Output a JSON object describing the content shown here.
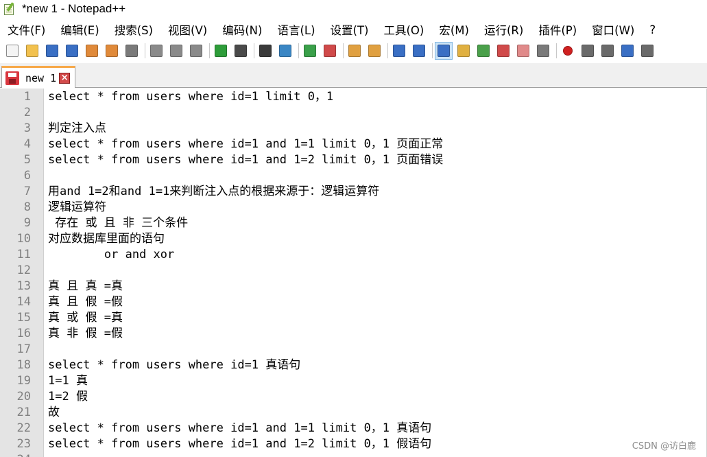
{
  "window": {
    "title": "*new 1 - Notepad++"
  },
  "menu": [
    "文件(F)",
    "编辑(E)",
    "搜索(S)",
    "视图(V)",
    "编码(N)",
    "语言(L)",
    "设置(T)",
    "工具(O)",
    "宏(M)",
    "运行(R)",
    "插件(P)",
    "窗口(W)",
    "?"
  ],
  "toolbar": {
    "icons": [
      {
        "name": "new-file-icon",
        "color": "#f4f4f4"
      },
      {
        "name": "open-file-icon",
        "color": "#f2c14e"
      },
      {
        "name": "save-icon",
        "color": "#3a6fc4"
      },
      {
        "name": "save-all-icon",
        "color": "#3a6fc4"
      },
      {
        "name": "close-icon",
        "color": "#e08a3a"
      },
      {
        "name": "close-all-icon",
        "color": "#e08a3a"
      },
      {
        "name": "print-icon",
        "color": "#7a7a7a"
      },
      {
        "name": "sep"
      },
      {
        "name": "cut-icon",
        "color": "#8a8a8a"
      },
      {
        "name": "copy-icon",
        "color": "#8a8a8a"
      },
      {
        "name": "paste-icon",
        "color": "#8a8a8a"
      },
      {
        "name": "sep"
      },
      {
        "name": "undo-icon",
        "color": "#2e9d3a"
      },
      {
        "name": "redo-icon",
        "color": "#4a4a4a"
      },
      {
        "name": "sep"
      },
      {
        "name": "find-icon",
        "color": "#3a3a3a"
      },
      {
        "name": "replace-icon",
        "color": "#3a86c4"
      },
      {
        "name": "sep"
      },
      {
        "name": "zoom-in-icon",
        "color": "#3aa04a"
      },
      {
        "name": "zoom-out-icon",
        "color": "#d04a4a"
      },
      {
        "name": "sep"
      },
      {
        "name": "sync-vertical-icon",
        "color": "#e0a040"
      },
      {
        "name": "sync-horizontal-icon",
        "color": "#e0a040"
      },
      {
        "name": "sep"
      },
      {
        "name": "word-wrap-icon",
        "color": "#3a6fc4"
      },
      {
        "name": "show-all-chars-icon",
        "color": "#3a6fc4"
      },
      {
        "name": "sep"
      },
      {
        "name": "indent-guide-icon",
        "color": "#3a6fc4",
        "active": true
      },
      {
        "name": "user-language-icon",
        "color": "#e0b040"
      },
      {
        "name": "document-map-icon",
        "color": "#4aa04a"
      },
      {
        "name": "function-list-icon",
        "color": "#d04a4a"
      },
      {
        "name": "folder-workspace-icon",
        "color": "#e08a8a"
      },
      {
        "name": "monitoring-icon",
        "color": "#7a7a7a"
      },
      {
        "name": "sep"
      },
      {
        "name": "macro-record-icon",
        "color": "#d02020"
      },
      {
        "name": "macro-stop-icon",
        "color": "#6a6a6a"
      },
      {
        "name": "macro-play-icon",
        "color": "#6a6a6a"
      },
      {
        "name": "macro-run-multiple-icon",
        "color": "#3a6fc4"
      },
      {
        "name": "macro-save-icon",
        "color": "#6a6a6a"
      }
    ]
  },
  "tab": {
    "label": "new 1",
    "close": "×"
  },
  "editor": {
    "lines": [
      "select * from users where id=1 limit 0，1",
      "",
      "判定注入点",
      "select * from users where id=1 and 1=1 limit 0，1 页面正常",
      "select * from users where id=1 and 1=2 limit 0，1 页面错误",
      "",
      "用and 1=2和and 1=1来判断注入点的根据来源于：逻辑运算符",
      "逻辑运算符",
      " 存在 或 且 非 三个条件",
      "对应数据库里面的语句",
      "\tor and xor",
      "",
      "真 且 真 =真",
      "真 且 假 =假",
      "真 或 假 =真",
      "真 非 假 =假",
      "",
      "select * from users where id=1 真语句",
      "1=1 真",
      "1=2 假",
      "故",
      "select * from users where id=1 and 1=1 limit 0，1 真语句",
      "select * from users where id=1 and 1=2 limit 0，1 假语句",
      ""
    ]
  },
  "watermark": "CSDN @访白鹿"
}
